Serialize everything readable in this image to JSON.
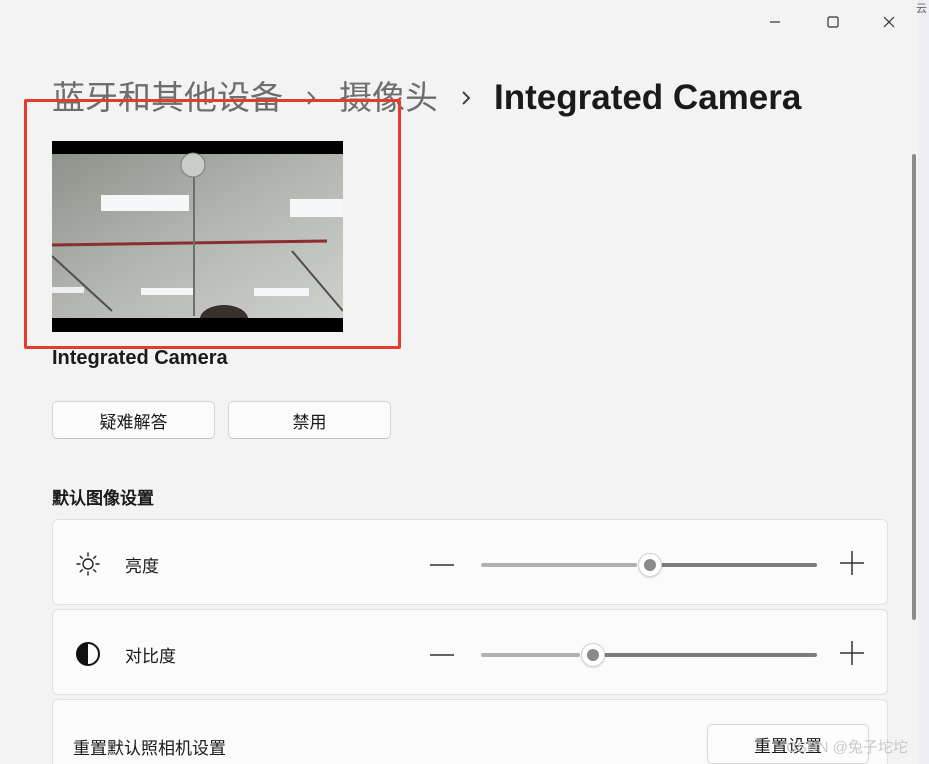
{
  "window": {
    "breadcrumb": [
      "蓝牙和其他设备",
      "摄像头"
    ],
    "current_page": "Integrated Camera",
    "caption_buttons": [
      "minimize-icon",
      "maximize-icon",
      "close-icon"
    ]
  },
  "camera": {
    "name": "Integrated Camera",
    "troubleshoot_label": "疑难解答",
    "disable_label": "禁用"
  },
  "default_image_settings": {
    "section_title": "默认图像设置",
    "brightness": {
      "label": "亮度",
      "value_fraction": 0.5
    },
    "contrast": {
      "label": "对比度",
      "value_fraction": 0.33
    }
  },
  "reset": {
    "label": "重置默认照相机设置",
    "button_label": "重置设置"
  },
  "overlay": {
    "highlight_color": "#e53a2e",
    "watermark": "CSDN @兔子坨坨"
  },
  "background": {
    "edge_text": "云"
  },
  "colors": {
    "window_bg": "#f3f3f3",
    "card_bg": "#fbfbfb",
    "slider_active": "#8a8a8a"
  }
}
